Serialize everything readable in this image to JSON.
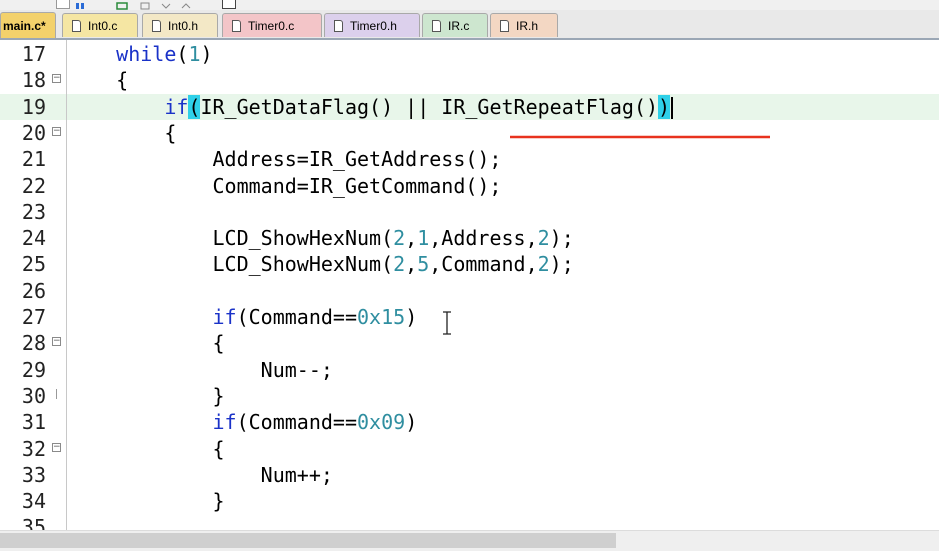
{
  "tabs": [
    {
      "label": "main.c*",
      "active": true,
      "color": "#f3d16b"
    },
    {
      "label": "Int0.c",
      "active": false,
      "color": "#f5e6a3"
    },
    {
      "label": "Int0.h",
      "active": false,
      "color": "#f3e8c6"
    },
    {
      "label": "Timer0.c",
      "active": false,
      "color": "#f3c5c8"
    },
    {
      "label": "Timer0.h",
      "active": false,
      "color": "#dcd0ec"
    },
    {
      "label": "IR.c",
      "active": false,
      "color": "#cde6cf"
    },
    {
      "label": "IR.h",
      "active": false,
      "color": "#f3d7c3"
    }
  ],
  "editor": {
    "lines": [
      {
        "n": "17",
        "fold": "",
        "segs": [
          [
            "p",
            "    "
          ],
          [
            "kw",
            "while"
          ],
          [
            "p",
            "("
          ],
          [
            "num",
            "1"
          ],
          [
            "p",
            ")"
          ]
        ]
      },
      {
        "n": "18",
        "fold": "start",
        "segs": [
          [
            "p",
            "    {"
          ]
        ]
      },
      {
        "n": "19",
        "fold": "",
        "current": true,
        "segs": [
          [
            "p",
            "        "
          ],
          [
            "kw",
            "if"
          ],
          [
            "brk",
            "("
          ],
          [
            "p",
            "IR_GetDataFlag() || IR_GetRepeatFlag()"
          ],
          [
            "brk",
            ")"
          ],
          [
            "caret",
            ""
          ]
        ]
      },
      {
        "n": "20",
        "fold": "start",
        "segs": [
          [
            "p",
            "        {"
          ]
        ]
      },
      {
        "n": "21",
        "fold": "",
        "segs": [
          [
            "p",
            "            Address=IR_GetAddress();"
          ]
        ]
      },
      {
        "n": "22",
        "fold": "",
        "segs": [
          [
            "p",
            "            Command=IR_GetCommand();"
          ]
        ]
      },
      {
        "n": "23",
        "fold": "",
        "segs": []
      },
      {
        "n": "24",
        "fold": "",
        "segs": [
          [
            "p",
            "            LCD_ShowHexNum("
          ],
          [
            "num",
            "2"
          ],
          [
            "p",
            ","
          ],
          [
            "num",
            "1"
          ],
          [
            "p",
            ",Address,"
          ],
          [
            "num",
            "2"
          ],
          [
            "p",
            ");"
          ]
        ]
      },
      {
        "n": "25",
        "fold": "",
        "segs": [
          [
            "p",
            "            LCD_ShowHexNum("
          ],
          [
            "num",
            "2"
          ],
          [
            "p",
            ","
          ],
          [
            "num",
            "5"
          ],
          [
            "p",
            ",Command,"
          ],
          [
            "num",
            "2"
          ],
          [
            "p",
            ");"
          ]
        ]
      },
      {
        "n": "26",
        "fold": "",
        "segs": []
      },
      {
        "n": "27",
        "fold": "",
        "segs": [
          [
            "p",
            "            "
          ],
          [
            "kw",
            "if"
          ],
          [
            "p",
            "(Command=="
          ],
          [
            "num",
            "0x15"
          ],
          [
            "p",
            ")"
          ]
        ]
      },
      {
        "n": "28",
        "fold": "start",
        "segs": [
          [
            "p",
            "            {"
          ]
        ]
      },
      {
        "n": "29",
        "fold": "",
        "segs": [
          [
            "p",
            "                Num--;"
          ]
        ]
      },
      {
        "n": "30",
        "fold": "end",
        "segs": [
          [
            "p",
            "            }"
          ]
        ]
      },
      {
        "n": "31",
        "fold": "",
        "segs": [
          [
            "p",
            "            "
          ],
          [
            "kw",
            "if"
          ],
          [
            "p",
            "(Command=="
          ],
          [
            "num",
            "0x09"
          ],
          [
            "p",
            ")"
          ]
        ]
      },
      {
        "n": "32",
        "fold": "start",
        "segs": [
          [
            "p",
            "            {"
          ]
        ]
      },
      {
        "n": "33",
        "fold": "",
        "segs": [
          [
            "p",
            "                Num++;"
          ]
        ]
      },
      {
        "n": "34",
        "fold": "",
        "segs": [
          [
            "p",
            "            }"
          ]
        ]
      },
      {
        "n": "35",
        "fold": "",
        "segs": []
      }
    ]
  },
  "colors": {
    "keyword": "#1a32c8",
    "number": "#2f8ea0",
    "bracket_highlight": "#2fd0e8",
    "current_line": "#e8f6ea",
    "annotation": "#e8321e"
  }
}
